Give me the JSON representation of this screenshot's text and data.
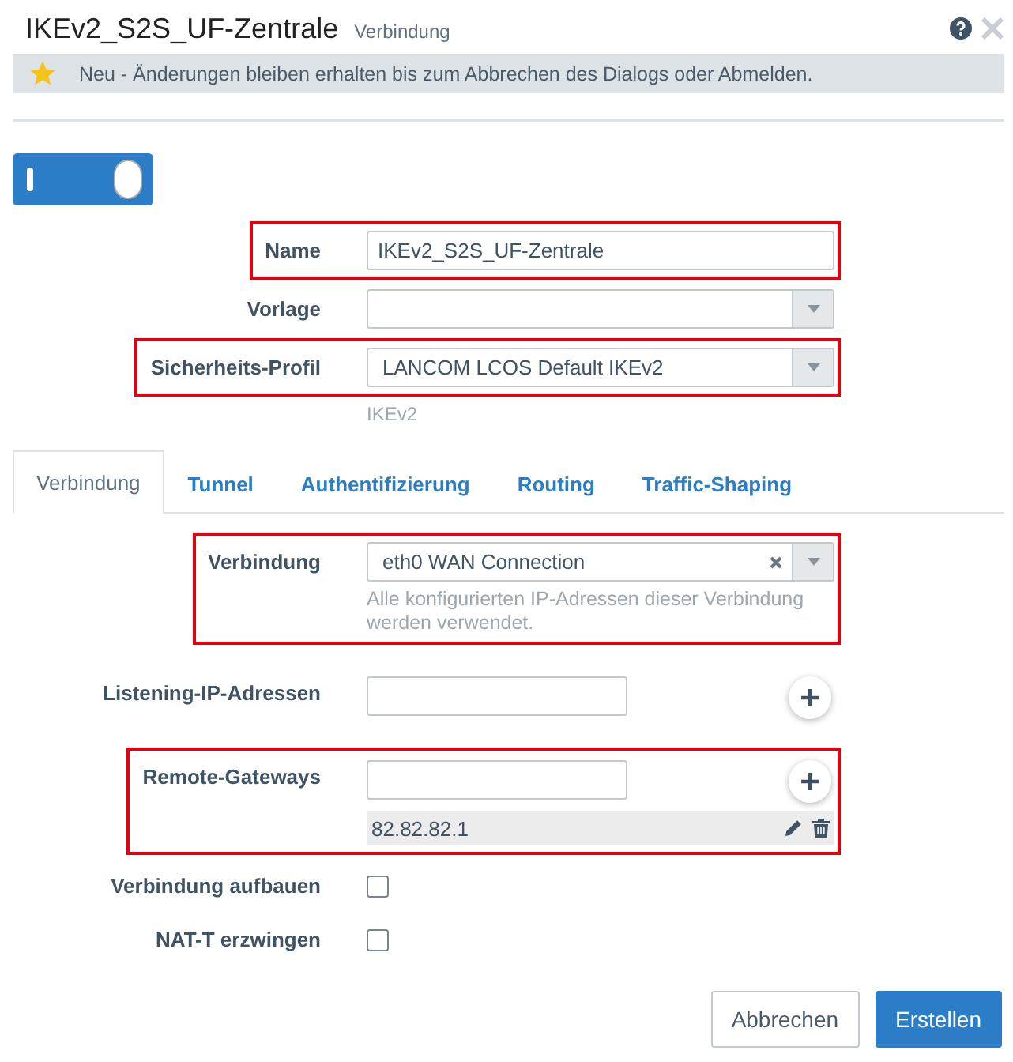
{
  "dialog": {
    "title": "IKEv2_S2S_UF-Zentrale",
    "subtitle": "Verbindung",
    "notice": "Neu - Änderungen bleiben erhalten bis zum Abbrechen des Dialogs oder Abmelden.",
    "enabled": true
  },
  "fields": [
    {
      "kind": "text",
      "label": "Name",
      "value": "IKEv2_S2S_UF-Zentrale",
      "highlighted": true
    },
    {
      "kind": "select",
      "label": "Vorlage",
      "highlighted": false
    },
    {
      "kind": "select",
      "label": "Sicherheits-Profil",
      "value": "LANCOM LCOS Default IKEv2",
      "hint": "IKEv2",
      "highlighted": true
    }
  ],
  "tabs": [
    {
      "label": "Verbindung",
      "selected": true
    },
    {
      "label": "Tunnel",
      "selected": false
    },
    {
      "label": "Authentifizierung",
      "selected": false
    },
    {
      "label": "Routing",
      "selected": false
    },
    {
      "label": "Traffic-Shaping",
      "selected": false
    }
  ],
  "connection_fields": [
    {
      "kind": "select",
      "label": "Verbindung",
      "value": "eth0 WAN Connection",
      "clearable": true,
      "hint": "Alle konfigurierten IP-Adressen dieser Verbindung werden verwendet.",
      "highlighted": true
    },
    {
      "kind": "list",
      "label": "Listening-IP-Adressen",
      "highlighted": false
    },
    {
      "kind": "list",
      "label": "Remote-Gateways",
      "entries": [
        "82.82.82.1"
      ],
      "highlighted": true
    },
    {
      "kind": "checkbox",
      "label": "Verbindung aufbauen",
      "checked": false
    },
    {
      "kind": "checkbox",
      "label": "NAT-T erzwingen",
      "checked": false
    }
  ],
  "buttons": [
    {
      "label": "Abbrechen",
      "primary": false
    },
    {
      "label": "Erstellen",
      "primary": true
    }
  ]
}
